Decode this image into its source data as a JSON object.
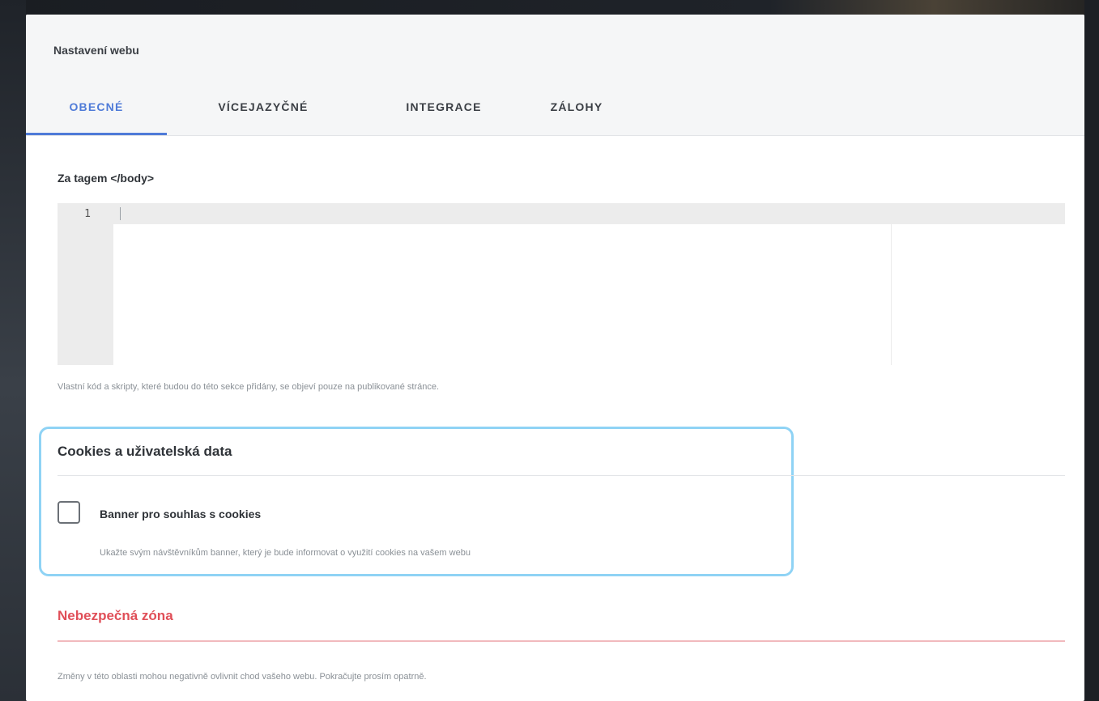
{
  "modal": {
    "title": "Nastavení webu"
  },
  "tabs": [
    {
      "label": "OBECNÉ",
      "active": true
    },
    {
      "label": "VÍCEJAZYČNÉ",
      "active": false
    },
    {
      "label": "INTEGRACE",
      "active": false
    },
    {
      "label": "ZÁLOHY",
      "active": false
    }
  ],
  "body_code": {
    "label": "Za tagem </body>",
    "line_numbers": [
      "1"
    ],
    "value": "",
    "helper": "Vlastní kód a skripty, které budou do této sekce přidány, se objeví pouze na publikované stránce."
  },
  "cookies": {
    "title": "Cookies a uživatelská data",
    "checkbox_label": "Banner pro souhlas s cookies",
    "checkbox_checked": false,
    "checkbox_description": "Ukažte svým návštěvníkům banner, který je bude informovat o využití cookies na vašem webu"
  },
  "danger_zone": {
    "title": "Nebezpečná zóna",
    "text": "Změny v této oblasti mohou negativně ovlivnit chod vašeho webu. Pokračujte prosím opatrně."
  },
  "colors": {
    "accent": "#4f7bd8",
    "highlight_border": "#8fd3f5",
    "danger": "#e04f58"
  }
}
